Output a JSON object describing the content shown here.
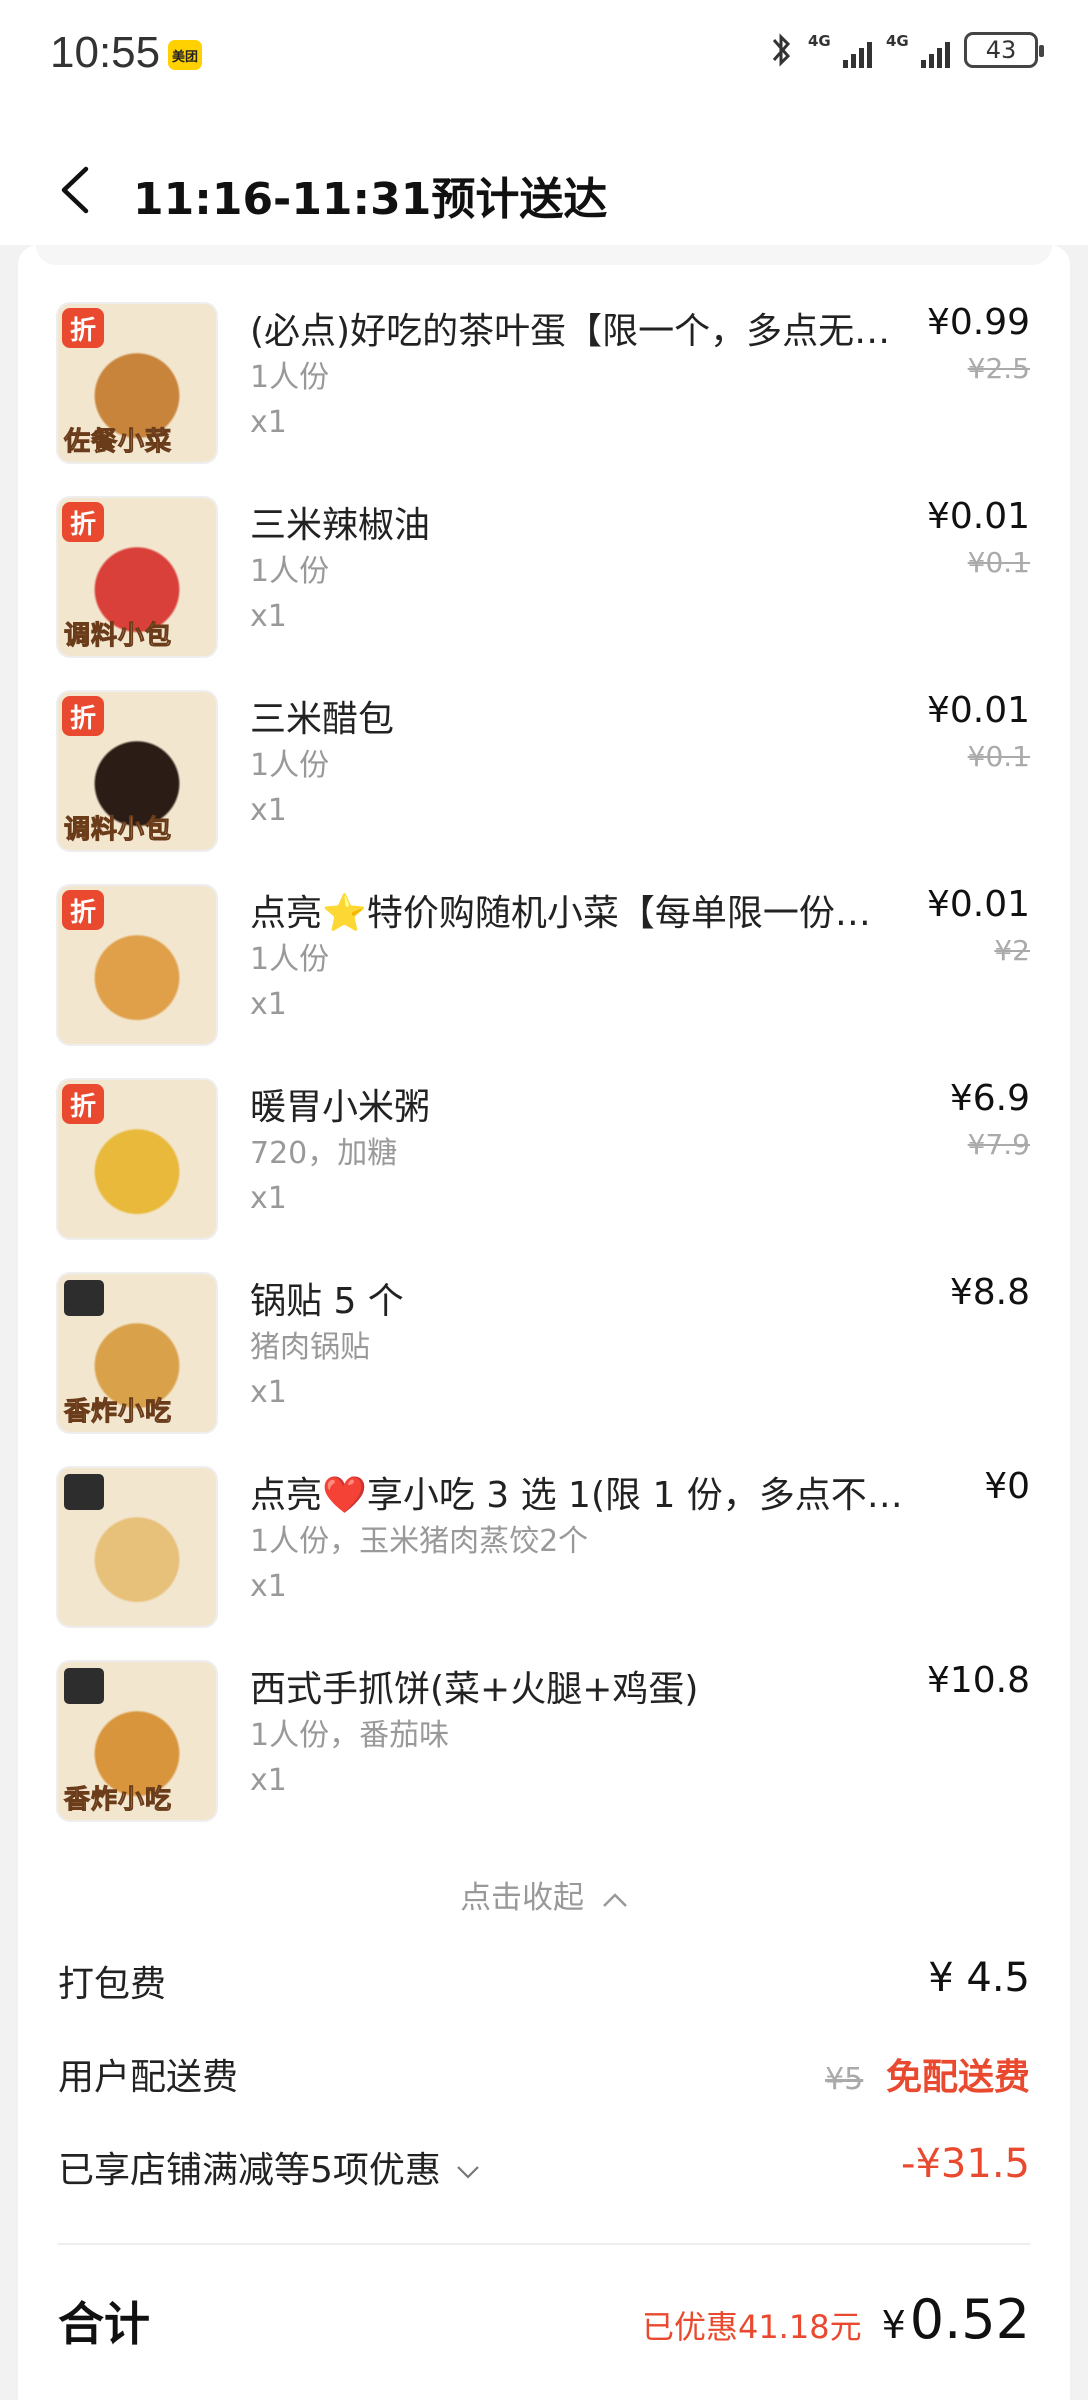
{
  "status": {
    "time": "10:55",
    "app_badge": "美团",
    "net1": "4G",
    "net2": "4G",
    "battery": "43"
  },
  "header": {
    "title": "11:16-11:31预计送达"
  },
  "items": [
    {
      "name": "(必点)好吃的茶叶蛋【限一个，多点无…",
      "spec": "1人份",
      "qty": "x1",
      "price": "¥0.99",
      "orig": "¥2.5",
      "discount": "折",
      "label": "佐餐小菜",
      "thumb_color": "#c8843a"
    },
    {
      "name": "三米辣椒油",
      "spec": "1人份",
      "qty": "x1",
      "price": "¥0.01",
      "orig": "¥0.1",
      "discount": "折",
      "label": "调料小包",
      "thumb_color": "#d9403a"
    },
    {
      "name": "三米醋包",
      "spec": "1人份",
      "qty": "x1",
      "price": "¥0.01",
      "orig": "¥0.1",
      "discount": "折",
      "label": "调料小包",
      "thumb_color": "#2b1c16"
    },
    {
      "name": "点亮⭐特价购随机小菜【每单限一份…",
      "spec": "1人份",
      "qty": "x1",
      "price": "¥0.01",
      "orig": "¥2",
      "discount": "折",
      "label": "",
      "thumb_color": "#e0a049"
    },
    {
      "name": "暖胃小米粥",
      "spec": "720，加糖",
      "qty": "x1",
      "price": "¥6.9",
      "orig": "¥7.9",
      "discount": "折",
      "label": "",
      "thumb_color": "#e8b93a"
    },
    {
      "name": "锅贴 5 个",
      "spec": "猪肉锅贴",
      "qty": "x1",
      "price": "¥8.8",
      "orig": "",
      "discount": "",
      "label": "香炸小吃",
      "thumb_color": "#d9a24a"
    },
    {
      "name": "点亮❤️享小吃 3 选 1(限 1 份，多点不…",
      "spec": "1人份，玉米猪肉蒸饺2个",
      "qty": "x1",
      "price": "¥0",
      "orig": "",
      "discount": "",
      "label": "",
      "thumb_color": "#e7c07a"
    },
    {
      "name": "西式手抓饼(菜+火腿+鸡蛋)",
      "spec": "1人份，番茄味",
      "qty": "x1",
      "price": "¥10.8",
      "orig": "",
      "discount": "",
      "label": "香炸小吃",
      "thumb_color": "#d8953c"
    }
  ],
  "collapse_label": "点击收起",
  "fees": {
    "packing_label": "打包费",
    "packing_value": "¥ 4.5",
    "delivery_label": "用户配送费",
    "delivery_orig": "¥5",
    "delivery_free": "免配送费",
    "promo_label": "已享店铺满减等5项优惠",
    "promo_value": "-¥31.5"
  },
  "total": {
    "label": "合计",
    "saved": "已优惠41.18元",
    "yen": "¥",
    "amount": "0.52"
  },
  "colors": {
    "accent_red": "#e94a2f",
    "brand_yellow": "#ffd100"
  }
}
